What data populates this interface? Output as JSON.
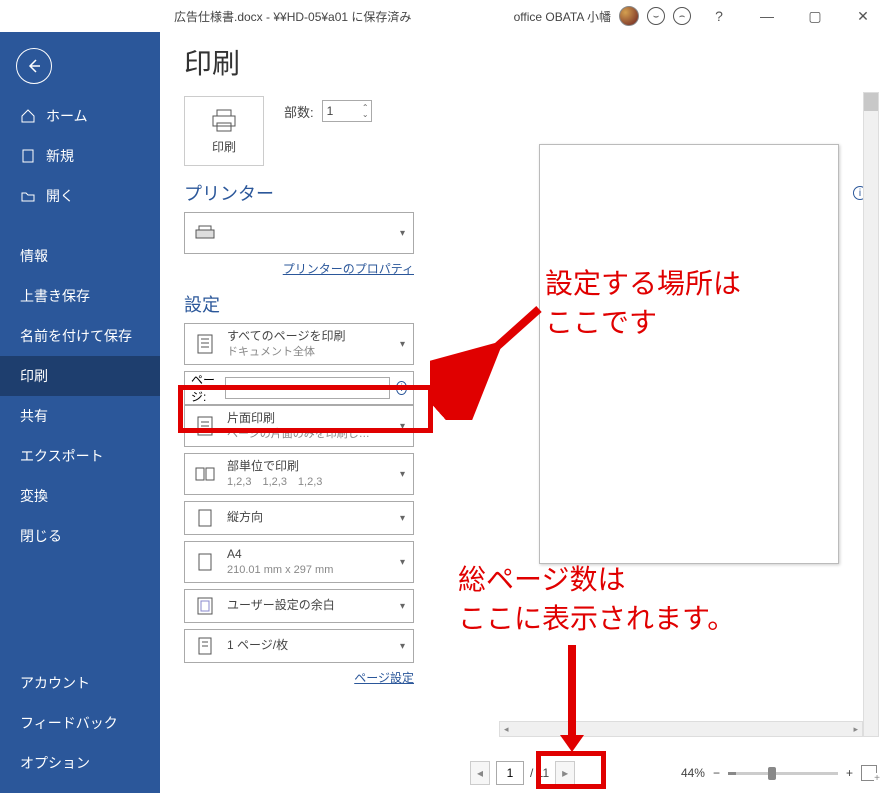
{
  "titlebar": {
    "doc_name": "広告仕様書.docx",
    "save_path": "¥¥HD-05¥a01 に保存済み",
    "user_label": "office OBATA 小幡",
    "help": "?"
  },
  "sidebar": {
    "home": "ホーム",
    "new": "新規",
    "open": "開く",
    "info": "情報",
    "save": "上書き保存",
    "saveas": "名前を付けて保存",
    "print": "印刷",
    "share": "共有",
    "export": "エクスポート",
    "transform": "変換",
    "close": "閉じる",
    "account": "アカウント",
    "feedback": "フィードバック",
    "options": "オプション"
  },
  "print": {
    "title": "印刷",
    "big_button": "印刷",
    "copies_label": "部数:",
    "copies_value": "1",
    "printer_head": "プリンター",
    "printer_props": "プリンターのプロパティ",
    "settings_head": "設定",
    "dd_allpages": {
      "main": "すべてのページを印刷",
      "sub": "ドキュメント全体"
    },
    "pages_label": "ページ:",
    "pages_value": "",
    "dd_oneside": {
      "main": "片面印刷",
      "sub": "ページの片面のみを印刷し…"
    },
    "dd_collate": {
      "main": "部単位で印刷",
      "sub": "1,2,3　1,2,3　1,2,3"
    },
    "dd_orient": {
      "main": "縦方向"
    },
    "dd_paper": {
      "main": "A4",
      "sub": "210.01 mm x 297 mm"
    },
    "dd_margin": {
      "main": "ユーザー設定の余白"
    },
    "dd_perpage": {
      "main": "1 ページ/枚"
    },
    "page_setup": "ページ設定"
  },
  "footer": {
    "current_page": "1",
    "total_pages": "/ 11",
    "zoom_pct": "44%"
  },
  "annotations": {
    "top": "設定する場所は\nここです",
    "bottom": "総ページ数は\nここに表示されます。"
  }
}
